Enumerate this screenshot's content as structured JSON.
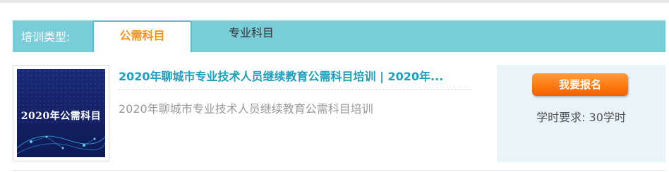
{
  "filter_bar": {
    "label": "培训类型:",
    "tabs": [
      {
        "label": "公需科目",
        "active": true
      },
      {
        "label": "专业科目",
        "active": false
      }
    ]
  },
  "course": {
    "thumbnail_text": "2020年公需科目",
    "title": "2020年聊城市专业技术人员继续教育公需科目培训 | 2020年...",
    "description": "2020年聊城市专业技术人员继续教育公需科目培训",
    "enroll_label": "我要报名",
    "hours_text": "学时要求: 30学时"
  },
  "colors": {
    "tab_bar": "#79cdd9",
    "active_tab_text": "#f39317",
    "title_link": "#1a9fbd",
    "enroll_button": "#ff7a10",
    "side_panel": "#e8f4f8"
  }
}
